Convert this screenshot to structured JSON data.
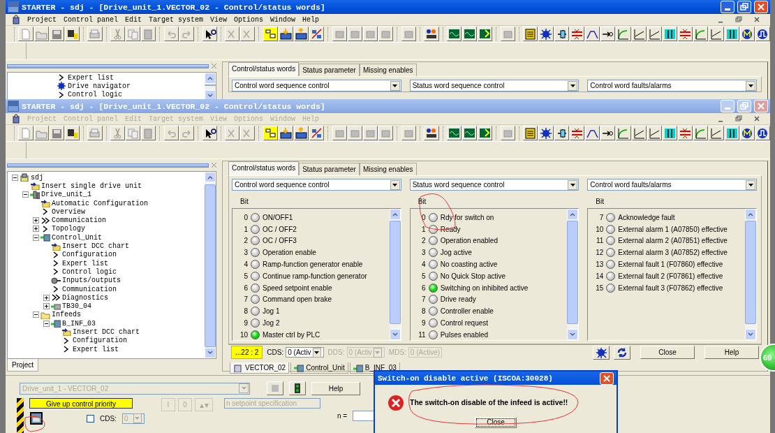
{
  "back_window": {
    "title": "STARTER - sdj - [Drive_unit_1.VECTOR_02 - Control/status words]",
    "active": true,
    "menu": {
      "disabled": false,
      "items": [
        "Project",
        "Control panel",
        "Edit",
        "Target system",
        "View",
        "Options",
        "Window",
        "Help"
      ]
    },
    "tree": [
      {
        "label": "Expert list",
        "kind": "chevron"
      },
      {
        "label": "Drive navigator",
        "kind": "navigator"
      },
      {
        "label": "Control logic",
        "kind": "chevron"
      }
    ],
    "tabs": [
      {
        "label": "Control/status words",
        "selected": true
      },
      {
        "label": "Status parameter",
        "selected": false
      },
      {
        "label": "Missing enables",
        "selected": false
      }
    ],
    "dropdowns": [
      "Control word sequence control",
      "Status word sequence control",
      "Control word faults/alarms"
    ]
  },
  "front_window": {
    "title": "STARTER - sdj - [Drive_unit_1.VECTOR_02 - Control/status words]",
    "active": false,
    "menu": {
      "disabled": true,
      "items": [
        "Project",
        "Control panel",
        "Edit",
        "Target system",
        "View",
        "Options",
        "Window",
        "Help"
      ]
    },
    "tree": [
      {
        "label": "sdj",
        "kind": "project",
        "expanded": true,
        "children": [
          {
            "label": "Insert single drive unit",
            "kind": "insert"
          },
          {
            "label": "Drive_unit_1",
            "kind": "device",
            "expanded": true,
            "children": [
              {
                "label": "Automatic Configuration",
                "kind": "insert"
              },
              {
                "label": "Overview",
                "kind": "chevron"
              },
              {
                "label": "Communication",
                "kind": "double",
                "expanded": false
              },
              {
                "label": "Topology",
                "kind": "chevron",
                "expanded": false
              },
              {
                "label": "Control_Unit",
                "kind": "cu",
                "expanded": true,
                "children": [
                  {
                    "label": "Insert DCC chart",
                    "kind": "insert"
                  },
                  {
                    "label": "Configuration",
                    "kind": "chevron"
                  },
                  {
                    "label": "Expert list",
                    "kind": "chevron"
                  },
                  {
                    "label": "Control logic",
                    "kind": "chevron"
                  },
                  {
                    "label": "Inputs/outputs",
                    "kind": "io"
                  },
                  {
                    "label": "Communication",
                    "kind": "chevron"
                  },
                  {
                    "label": "Diagnostics",
                    "kind": "double",
                    "expanded": false
                  },
                  {
                    "label": "TB30_04",
                    "kind": "module",
                    "expanded": false
                  }
                ]
              },
              {
                "label": "Infeeds",
                "kind": "folder",
                "expanded": true,
                "children": [
                  {
                    "label": "B_INF_03",
                    "kind": "infeed",
                    "expanded": true,
                    "children": [
                      {
                        "label": "Insert DCC chart",
                        "kind": "insert"
                      },
                      {
                        "label": "Configuration",
                        "kind": "chevron"
                      },
                      {
                        "label": "Expert list",
                        "kind": "chevron"
                      }
                    ]
                  }
                ]
              }
            ]
          }
        ]
      }
    ],
    "project_tab": "Project",
    "tabs": [
      {
        "label": "Control/status words",
        "selected": true
      },
      {
        "label": "Status parameter",
        "selected": false
      },
      {
        "label": "Missing enables",
        "selected": false
      }
    ],
    "dropdowns": [
      "Control word sequence control",
      "Status word sequence control",
      "Control word faults/alarms"
    ],
    "lists": [
      {
        "header": "Bit",
        "items": [
          {
            "bit": "0",
            "label": "ON/OFF1",
            "on": false
          },
          {
            "bit": "1",
            "label": "OC / OFF2",
            "on": false
          },
          {
            "bit": "2",
            "label": "OC / OFF3",
            "on": false
          },
          {
            "bit": "3",
            "label": "Operation enable",
            "on": false
          },
          {
            "bit": "4",
            "label": "Ramp-function generator enable",
            "on": false
          },
          {
            "bit": "5",
            "label": "Continue ramp-function generator",
            "on": false
          },
          {
            "bit": "6",
            "label": "Speed setpoint enable",
            "on": false
          },
          {
            "bit": "7",
            "label": "Command open brake",
            "on": false
          },
          {
            "bit": "8",
            "label": "Jog 1",
            "on": false
          },
          {
            "bit": "9",
            "label": "Jog 2",
            "on": false
          },
          {
            "bit": "10",
            "label": "Master ctrl by PLC",
            "on": true
          }
        ]
      },
      {
        "header": "Bit",
        "items": [
          {
            "bit": "0",
            "label": "Rdy for switch on",
            "on": false
          },
          {
            "bit": "1",
            "label": "Ready",
            "on": false
          },
          {
            "bit": "2",
            "label": "Operation enabled",
            "on": false
          },
          {
            "bit": "3",
            "label": "Jog active",
            "on": false
          },
          {
            "bit": "4",
            "label": "No coasting active",
            "on": false
          },
          {
            "bit": "5",
            "label": "No Quick Stop active",
            "on": false
          },
          {
            "bit": "6",
            "label": "Switching on inhibited active",
            "on": true
          },
          {
            "bit": "7",
            "label": "Drive ready",
            "on": false
          },
          {
            "bit": "8",
            "label": "Controller enable",
            "on": false
          },
          {
            "bit": "9",
            "label": "Control request",
            "on": false
          },
          {
            "bit": "11",
            "label": "Pulses enabled",
            "on": false
          }
        ]
      },
      {
        "header": "Bit",
        "items": [
          {
            "bit": "7",
            "label": "Acknowledge fault",
            "on": false
          },
          {
            "bit": "10",
            "label": "External alarm 1 (A07850) effective",
            "on": false
          },
          {
            "bit": "11",
            "label": "External alarm 2 (A07851) effective",
            "on": false
          },
          {
            "bit": "12",
            "label": "External alarm 3 (A07852) effective",
            "on": false
          },
          {
            "bit": "13",
            "label": "External fault 1 (F07860) effective",
            "on": false
          },
          {
            "bit": "14",
            "label": "External fault 2 (F07861) effective",
            "on": false
          },
          {
            "bit": "15",
            "label": "External fault 3 (F07862) effective",
            "on": false
          }
        ]
      }
    ],
    "status_bar": {
      "counter": "...22 : 2",
      "fields": [
        {
          "label": "CDS:",
          "value": "0 (Activ",
          "kind": "select",
          "disabled": false
        },
        {
          "label": "DDS:",
          "value": "0 (Activ",
          "kind": "select",
          "disabled": true
        },
        {
          "label": "MDS:",
          "value": "0 (Active)",
          "kind": "text",
          "disabled": true
        }
      ],
      "buttons": [
        "Close",
        "Help"
      ]
    },
    "doc_tabs": [
      {
        "label": "VECTOR_02",
        "kind": "drive",
        "selected": true
      },
      {
        "label": "Control_Unit",
        "kind": "cu",
        "selected": false
      },
      {
        "label": "B_INF_03",
        "kind": "infeed",
        "selected": false
      }
    ]
  },
  "control_panel": {
    "drive_select": "Drive_unit_1 - VECTOR_02",
    "help": "Help",
    "priority_button": "Give up control priority",
    "on_button": "I",
    "off_button": "0",
    "setpoint": "n setpoint specification",
    "cds": {
      "label": "CDS:",
      "checked": false,
      "value": "0"
    },
    "n_label": "n ="
  },
  "dialog": {
    "title": "Switch-on disable active (ISCOA:30028)",
    "message": "The switch-on disable of the infeed is active!!",
    "button": "Close"
  },
  "desktop_badge": "69"
}
